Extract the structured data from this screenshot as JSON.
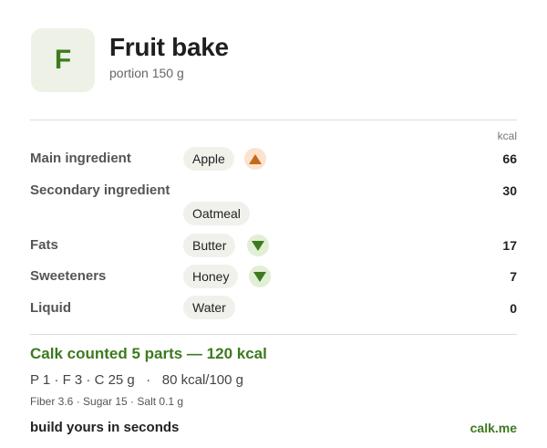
{
  "header": {
    "logo_letter": "F",
    "title": "Fruit bake",
    "subtitle": "portion 150 g"
  },
  "table": {
    "unit_label": "kcal",
    "rows": [
      {
        "label": "Main ingredient",
        "ingredient": "Apple",
        "trend": "up-icon",
        "kcal": "66"
      },
      {
        "label": "Secondary ingredient",
        "ingredient": "Oatmeal",
        "trend": "",
        "kcal": "30"
      },
      {
        "label": "Fats",
        "ingredient": "Butter",
        "trend": "down-icon",
        "kcal": "17"
      },
      {
        "label": "Sweeteners",
        "ingredient": "Honey",
        "trend": "down-icon",
        "kcal": "7"
      },
      {
        "label": "Liquid",
        "ingredient": "Water",
        "trend": "",
        "kcal": "0"
      }
    ]
  },
  "summary": {
    "headline": "Calk counted 5 parts — 120 kcal",
    "macros": "P 1 · F 3 · C 25 g   ·   80 kcal/100 g",
    "micros": "Fiber 3.6 · Sugar 15 · Salt 0.1 g"
  },
  "footer": {
    "tagline": "build yours in seconds",
    "brand": "calk.me"
  },
  "colors": {
    "accent_green": "#3d7a1f",
    "up_orange": "#c4691c",
    "chip_bg": "#f1f1ec"
  }
}
